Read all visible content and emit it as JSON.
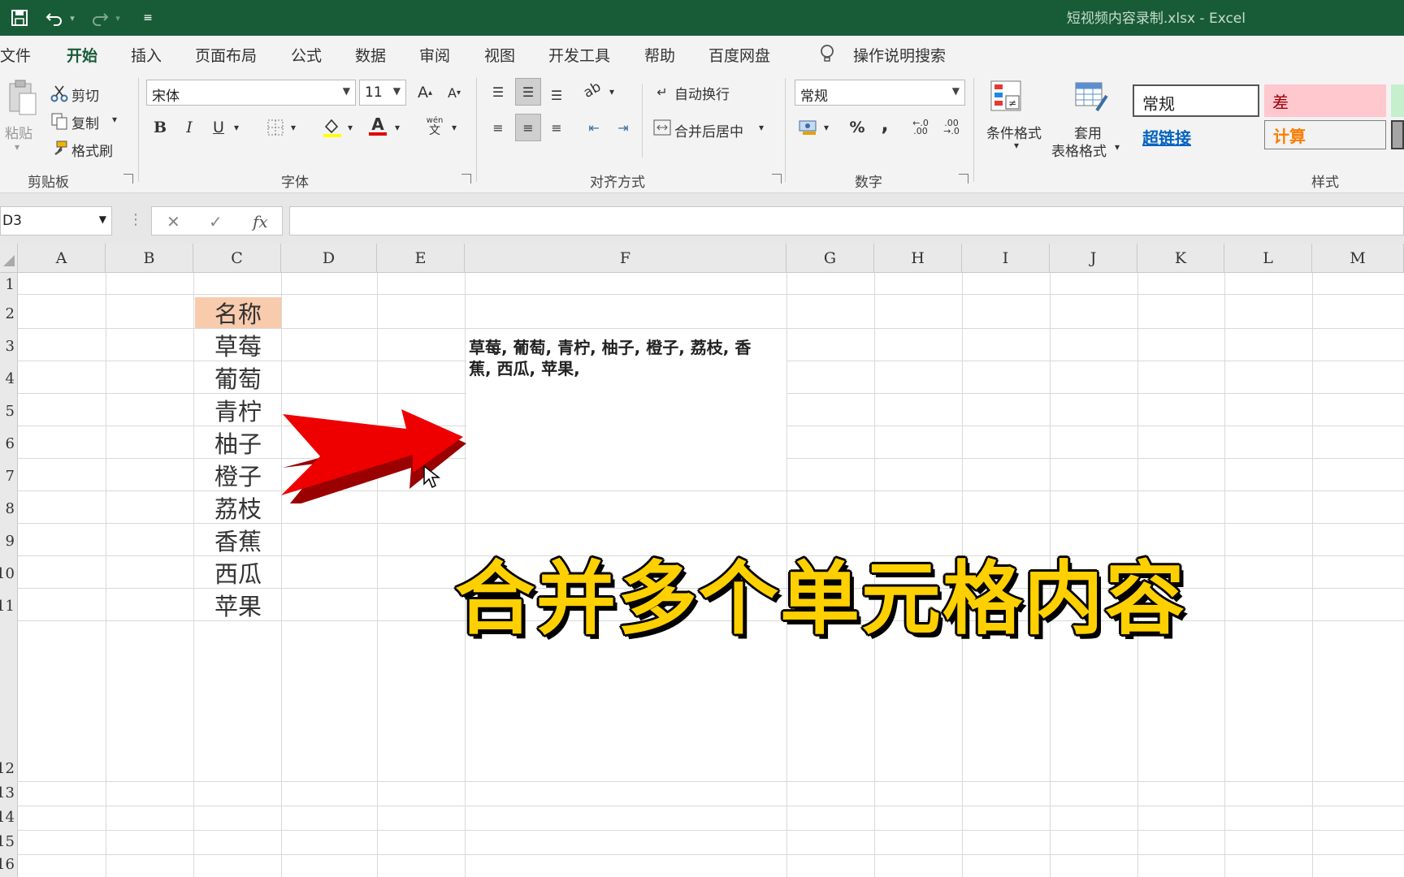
{
  "window": {
    "title": "短视频内容录制.xlsx  -  Excel"
  },
  "quick_access": {
    "save_icon": "save-icon",
    "undo_icon": "undo-icon",
    "redo_icon": "redo-icon",
    "customize_icon": "customize-icon"
  },
  "tabs": [
    "文件",
    "开始",
    "插入",
    "页面布局",
    "公式",
    "数据",
    "审阅",
    "视图",
    "开发工具",
    "帮助",
    "百度网盘"
  ],
  "active_tab": "开始",
  "tell_me": "操作说明搜索",
  "clipboard": {
    "paste": "粘贴",
    "cut": "剪切",
    "copy": "复制",
    "format_painter": "格式刷",
    "group": "剪贴板"
  },
  "font": {
    "name": "宋体",
    "size": "11",
    "bold": "B",
    "italic": "I",
    "underline": "U",
    "color_letter": "A",
    "group": "字体"
  },
  "alignment": {
    "wrap": "自动换行",
    "merge": "合并后居中",
    "group": "对齐方式"
  },
  "number": {
    "format": "常规",
    "percent": "%",
    "comma": ",",
    "group": "数字"
  },
  "styles": {
    "conditional": "条件格式",
    "table1": "套用",
    "table2": "表格格式",
    "normal": "常规",
    "bad": "差",
    "hyperlink": "超链接",
    "calc": "计算",
    "group": "样式",
    "colors": {
      "bad_bg": "#ffc7ce",
      "bad_fg": "#9c0006",
      "calc_fg": "#fa7d00",
      "link": "#0563c1"
    }
  },
  "formula_bar": {
    "name_box": "D3",
    "cancel": "✕",
    "enter": "✓",
    "fx": "fx",
    "value": ""
  },
  "columns": [
    "A",
    "B",
    "C",
    "D",
    "E",
    "F",
    "G",
    "H",
    "I",
    "J",
    "K",
    "L",
    "M"
  ],
  "rows": [
    "1",
    "2",
    "3",
    "4",
    "5",
    "6",
    "7",
    "8",
    "9",
    "10",
    "11",
    "12",
    "13",
    "14",
    "15",
    "16"
  ],
  "cells": {
    "C2": "名称",
    "fruits": [
      "草莓",
      "葡萄",
      "青柠",
      "柚子",
      "橙子",
      "荔枝",
      "香蕉",
      "西瓜",
      "苹果"
    ],
    "F4": "草莓, 葡萄, 青柠, 柚子, 橙子, 荔枝, 香蕉, 西瓜, 苹果,"
  },
  "overlay": {
    "caption": "合并多个单元格内容",
    "arrow_color": "#ee0000",
    "caption_color": "#ffd000"
  }
}
